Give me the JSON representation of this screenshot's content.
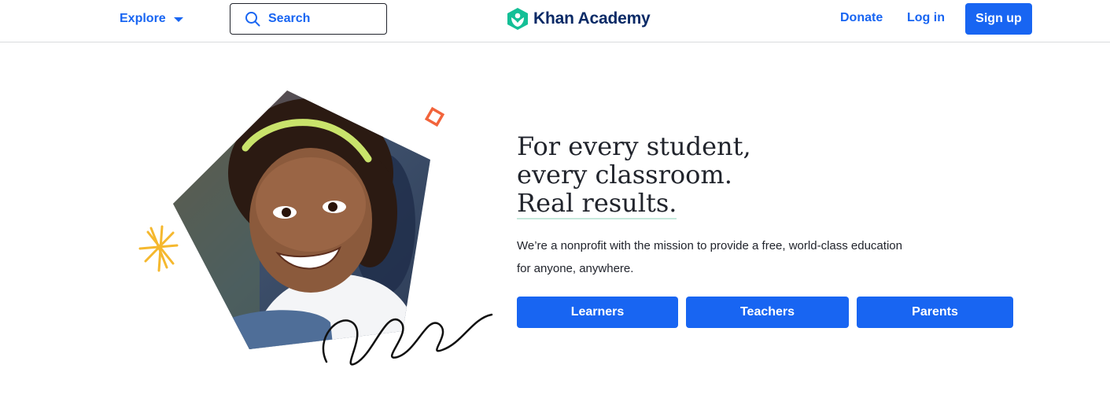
{
  "nav": {
    "explore_label": "Explore",
    "search_label": "Search",
    "logo_text": "Khan Academy",
    "donate_label": "Donate",
    "login_label": "Log in",
    "signup_label": "Sign up"
  },
  "hero": {
    "headline": [
      "For every student,",
      "every classroom.",
      "Real results."
    ],
    "mission": [
      "We’re a nonprofit with the mission to provide a free, world-class education",
      "for anyone, anywhere."
    ],
    "ctas": [
      "Learners",
      "Teachers",
      "Parents"
    ]
  },
  "colors": {
    "accent": "#1865f2",
    "logo_green": "#14bf96",
    "logo_navy": "#0a2a66",
    "text": "#21242c",
    "decor_orange": "#f2643b",
    "decor_yellow": "#f5b82e"
  },
  "icons": [
    "chevron-down-icon",
    "search-icon",
    "khan-logo-icon",
    "starburst-icon",
    "diamond-outline-icon",
    "squiggle-icon"
  ]
}
